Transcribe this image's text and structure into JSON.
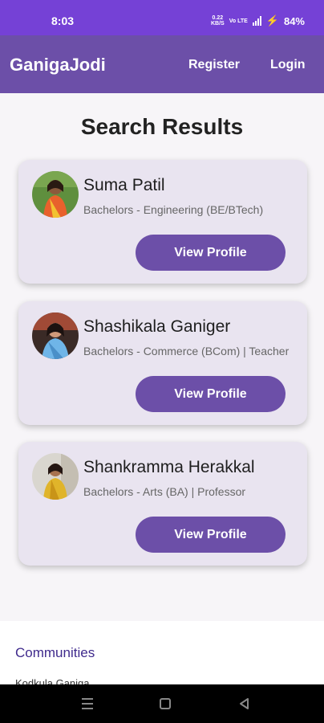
{
  "status": {
    "time": "8:03",
    "speed_value": "0.22",
    "speed_unit": "KB/S",
    "network": "Vo LTE",
    "battery": "84%"
  },
  "appbar": {
    "brand": "GanigaJodi",
    "register": "Register",
    "login": "Login"
  },
  "title": "Search Results",
  "results": [
    {
      "name": "Suma Patil",
      "detail": "Bachelors - Engineering (BE/BTech)",
      "button": "View Profile"
    },
    {
      "name": "Shashikala Ganiger",
      "detail": "Bachelors - Commerce (BCom) | Teacher",
      "button": "View Profile"
    },
    {
      "name": "Shankramma Herakkal",
      "detail": "Bachelors - Arts (BA) | Professor",
      "button": "View Profile"
    }
  ],
  "footer": {
    "communities": "Communities",
    "first_link": "Kodkula Ganiga"
  },
  "colors": {
    "status_bar": "#7541d6",
    "app_bar": "#6c4fa8",
    "card": "#e9e4f0",
    "button": "#6c4fa8"
  },
  "icons": [
    "signal-icon",
    "charging-icon",
    "menu-nav-icon",
    "home-nav-icon",
    "back-nav-icon"
  ]
}
